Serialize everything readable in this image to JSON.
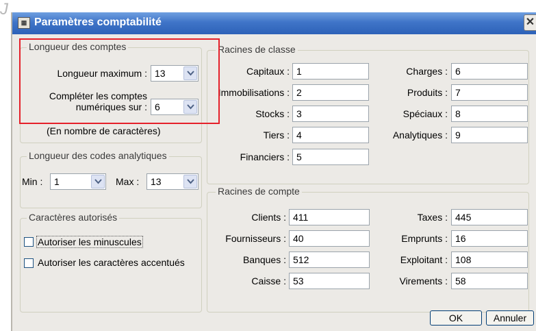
{
  "window": {
    "title": "Paramètres comptabilité",
    "icon": "app-icon",
    "close_icon": "close-icon"
  },
  "watermark": "J",
  "longueur_comptes": {
    "legend": "Longueur des comptes",
    "max_label": "Longueur maximum :",
    "max_value": "13",
    "completer_label_line1": "Compléter les comptes",
    "completer_label_line2": "numériques sur :",
    "completer_value": "6",
    "note": "(En nombre de caractères)"
  },
  "codes_analytiques": {
    "legend": "Longueur des codes analytiques",
    "min_label": "Min :",
    "min_value": "1",
    "max_label": "Max :",
    "max_value": "13"
  },
  "caracteres": {
    "legend": "Caractères autorisés",
    "minuscules_label": "Autoriser les minuscules",
    "minuscules_checked": false,
    "accentues_label": "Autoriser les caractères accentués",
    "accentues_checked": false
  },
  "racines_classe": {
    "legend": "Racines de classe",
    "left": [
      {
        "label": "Capitaux :",
        "value": "1"
      },
      {
        "label": "Immobilisations :",
        "value": "2"
      },
      {
        "label": "Stocks :",
        "value": "3"
      },
      {
        "label": "Tiers :",
        "value": "4"
      },
      {
        "label": "Financiers :",
        "value": "5"
      }
    ],
    "right": [
      {
        "label": "Charges :",
        "value": "6"
      },
      {
        "label": "Produits :",
        "value": "7"
      },
      {
        "label": "Spéciaux :",
        "value": "8"
      },
      {
        "label": "Analytiques :",
        "value": "9"
      }
    ]
  },
  "racines_compte": {
    "legend": "Racines de compte",
    "left": [
      {
        "label": "Clients :",
        "value": "411"
      },
      {
        "label": "Fournisseurs :",
        "value": "40"
      },
      {
        "label": "Banques :",
        "value": "512"
      },
      {
        "label": "Caisse :",
        "value": "53"
      }
    ],
    "right": [
      {
        "label": "Taxes :",
        "value": "445"
      },
      {
        "label": "Emprunts :",
        "value": "16"
      },
      {
        "label": "Exploitant :",
        "value": "108"
      },
      {
        "label": "Virements :",
        "value": "58"
      }
    ]
  },
  "buttons": {
    "ok": "OK",
    "cancel": "Annuler"
  },
  "colors": {
    "title_bar": "#2d62b8",
    "highlight": "#e5202a",
    "dialog_bg": "#eceae6"
  }
}
